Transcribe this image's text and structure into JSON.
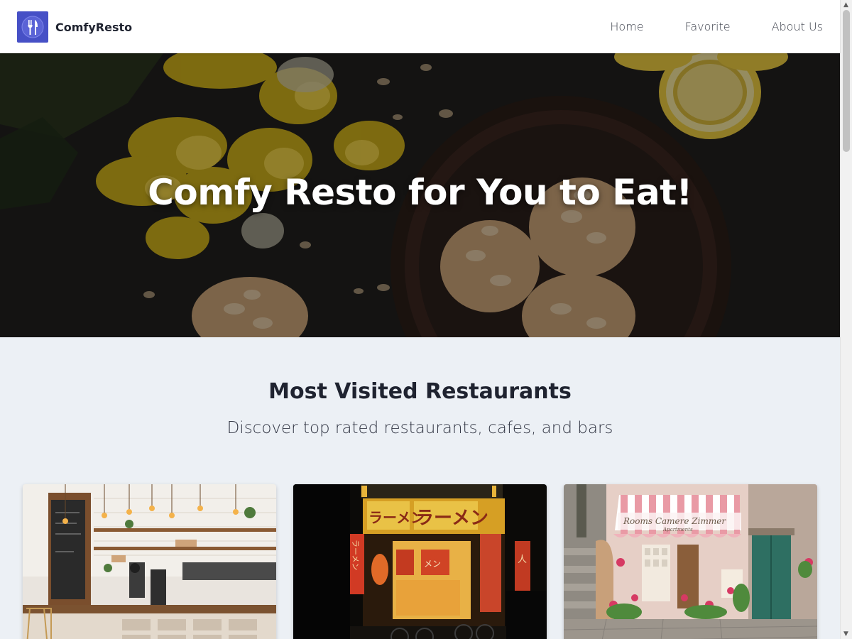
{
  "brand": {
    "name": "ComfyResto",
    "logo_icon": "fork-knife-icon",
    "logo_color": "#4650c6"
  },
  "nav": {
    "items": [
      {
        "label": "Home"
      },
      {
        "label": "Favorite"
      },
      {
        "label": "About Us"
      }
    ]
  },
  "hero": {
    "title": "Comfy Resto for You to Eat!"
  },
  "main": {
    "title": "Most Visited Restaurants",
    "subtitle": "Discover top rated restaurants, cafes, and bars",
    "cards": [
      {
        "image": "cafe-interior-image"
      },
      {
        "image": "ramen-shop-night-image",
        "signs": [
          "ラーメン",
          "ラーメン",
          "ラーメン",
          "メン",
          "人"
        ]
      },
      {
        "image": "flower-shop-street-image",
        "awning_text": "Rooms Camere Zimmer",
        "awning_subtext": "Apartments"
      }
    ]
  },
  "colors": {
    "header_bg": "#ffffff",
    "page_bg": "#ecf0f5",
    "text_dark": "#1f2330"
  }
}
